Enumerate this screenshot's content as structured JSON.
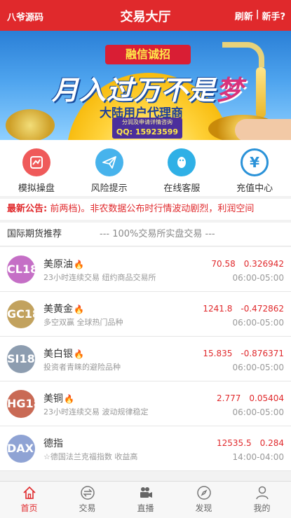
{
  "header": {
    "brand": "八爷源码",
    "title": "交易大厅",
    "refresh": "刷新",
    "separator": "|",
    "newbie": "新手?"
  },
  "banner": {
    "ribbon": "融信诚招",
    "slogan_main": "月入过万不是",
    "slogan_highlight": "梦",
    "subtitle": "大陆用户代理商",
    "apply_text": "分润及申请详情咨询",
    "qq": "QQ: 15923599"
  },
  "quick_actions": [
    {
      "label": "模拟操盘",
      "icon": "simulate-trade-icon",
      "color": "#ef5a5a"
    },
    {
      "label": "风险提示",
      "icon": "paper-plane-icon",
      "color": "#47b3ec"
    },
    {
      "label": "在线客服",
      "icon": "penguin-qq-icon",
      "color": "#2fb0e6"
    },
    {
      "label": "充值中心",
      "icon": "yuan-icon",
      "color": "#2a92d8"
    }
  ],
  "notice": {
    "label": "最新公告:",
    "text": "前两档)。非农数据公布时行情波动剧烈，利润空间"
  },
  "section": {
    "title": "国际期货推荐",
    "subtitle": "--- 100%交易所实盘交易 ---"
  },
  "products": [
    {
      "code": "CL1810",
      "name": "美原油",
      "desc": "23小时连续交易 纽约商品交易所",
      "price": "70.58",
      "change": "0.326942",
      "time": "06:00-05:00",
      "color": "#c56fc6"
    },
    {
      "code": "GC1812",
      "name": "美黄金",
      "desc": "多空双赢 全球热门品种",
      "price": "1241.8",
      "change": "-0.472862",
      "time": "06:00-05:00",
      "color": "#c2a25e"
    },
    {
      "code": "SI1809",
      "name": "美白银",
      "desc": "投资者青睐的避险品种",
      "price": "15.835",
      "change": "-0.876371",
      "time": "06:00-05:00",
      "color": "#8d9db0"
    },
    {
      "code": "HG1809",
      "name": "美铜",
      "desc": "23小时连续交易 波动规律稳定",
      "price": "2.777",
      "change": "0.05404",
      "time": "06:00-05:00",
      "color": "#c96a55"
    },
    {
      "code": "DAX1809",
      "name": "德指",
      "desc": "☆德国法兰克福指数 收益高",
      "price": "12535.5",
      "change": "0.284",
      "time": "14:00-04:00",
      "color": "#8fa3d4"
    }
  ],
  "tabbar": [
    {
      "label": "首页",
      "icon": "home-icon",
      "active": true
    },
    {
      "label": "交易",
      "icon": "exchange-icon",
      "active": false
    },
    {
      "label": "直播",
      "icon": "video-camera-icon",
      "active": false
    },
    {
      "label": "发现",
      "icon": "compass-icon",
      "active": false
    },
    {
      "label": "我的",
      "icon": "user-icon",
      "active": false
    }
  ],
  "colors": {
    "primary": "#e0292c",
    "up": "#e0292c"
  }
}
